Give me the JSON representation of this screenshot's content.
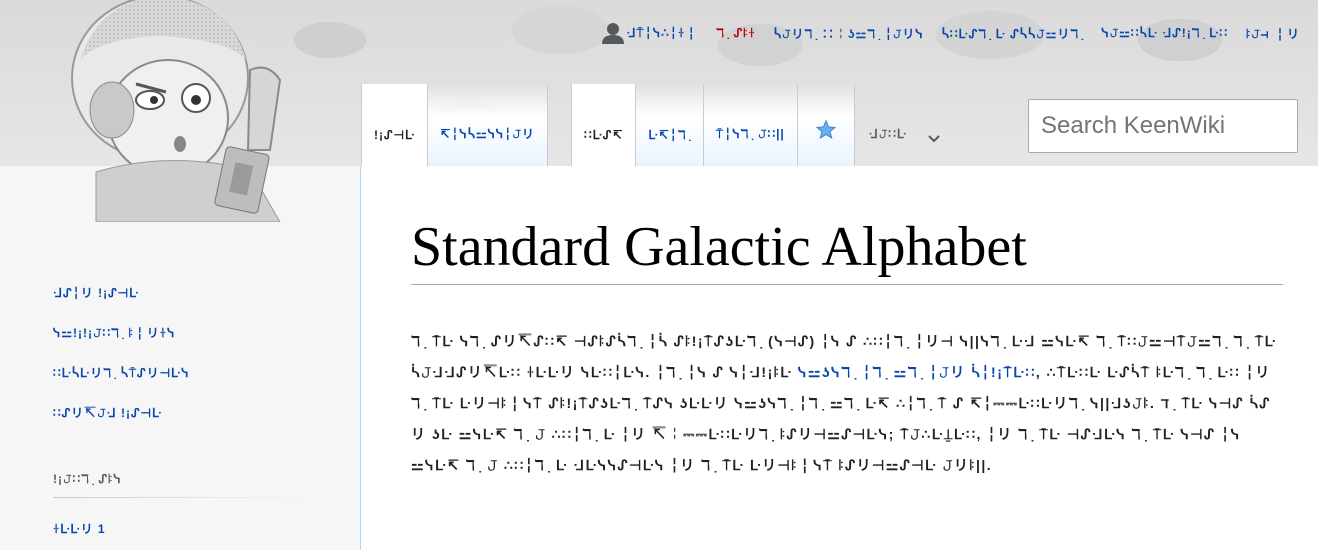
{
  "personal_tools": {
    "login": "ᒲ⍑╎ᓭ∴╎ꖌ╎",
    "talk": "ℸ ̣ ᔑꖎꖌ",
    "contributions": "ᓵ𝙹リℸ ̣ ∷╎ʖ⚍ℸ ̣ ╎𝙹リᓭ",
    "create_account": "ᓵ∷ᒷᔑℸ ̣ ᒷ ᔑᓵᓵ𝙹⚍リℸ ̣",
    "preferences": "ᓭ𝙹⚍∷ᓵᒷ ᒲᔑ!¡ℸ ̣ ᒷ∷",
    "log_in": "ꖎ𝙹⊣ ╎リ"
  },
  "tabs": {
    "page": "!¡ᔑ⊣ᒷ",
    "discussion": "↸╎ᓭᓵ⚍ᓭᓭ╎𝙹リ",
    "read": "∷ᒷᔑ↸",
    "edit": "ᒷ↸╎ℸ ̣",
    "history": "⍑╎ᓭℸ ̣ 𝙹∷||",
    "more": "ᒲ𝙹∷ᒷ"
  },
  "search": {
    "placeholder": "Search KeenWiki"
  },
  "sidebar": {
    "nav": [
      "ᒲᔑ╎リ !¡ᔑ⊣ᒷ",
      "ᓭ⚍!¡!¡𝙹∷ℸ ̣ ꖎ╎リꖌᓭ",
      "∷ᒷᓵᒷリℸ ̣ ᓵ⍑ᔑリ⊣ᒷᓭ",
      "∷ᔑリ↸𝙹ᒲ !¡ᔑ⊣ᒷ"
    ],
    "portal_heading": "!¡𝙹∷ℸ ̣ ᔑꖎᓭ",
    "portal_first": "ꖌᒷᒷリ 1"
  },
  "page_title": "Standard Galactic Alphabet",
  "article": {
    "p1": "ℸ ̣ ⍑ᒷ ",
    "bold": "ᓭℸ ̣ ᔑリ↸ᔑ∷↸ ⊣ᔑꖎᔑᓵℸ ̣ ╎ᓵ ᔑꖎ!¡⍑ᔑʖᒷℸ ̣",
    "p2": " (ᓭ⊣ᔑ) ╎ᓭ ᔑ ∴∷╎ℸ ̣ ╎リ⊣ ᓭ||ᓭℸ ̣ ᒷᒲ ⚍ᓭᒷ↸ ℸ ̣ ⍑∷𝙹⚍⊣⍑𝙹⚍ℸ ̣ ℸ ̣ ⍑ᒷ ᓵ𝙹ᒲᒲᔑリ↸ᒷ∷ ꖌᒷᒷリ ᓭᒷ∷╎ᒷᓭ. ╎ℸ ̣ ╎ᓭ ᔑ ᓭ╎ᒲ!¡ꖎᒷ ",
    "link": "ᓭ⚍ʖᓭℸ ̣ ╎ℸ ̣ ⚍ℸ ̣ ╎𝙹リ ᓵ╎!¡⍑ᒷ∷",
    "p3": ", ∴⍑ᒷ∷ᒷ ᒷᔑᓵ⍑ ꖎᒷℸ ̣ ℸ ̣ ᒷ∷ ╎リ ℸ ̣ ⍑ᒷ ᒷリ⊣ꖎ╎ᓭ⍑ ᔑꖎ!¡⍑ᔑʖᒷℸ ̣ ⍑ᔑᓭ ʖᒷᒷリ ᓭ⚍ʖᓭℸ ̣ ╎ℸ ̣ ⚍ℸ ̣ ᒷ↸ ∴╎ℸ ̣ ⍑ ᔑ ↸╎⎓⎓ᒷ∷ᒷリℸ ̣ ᓭ||ᒲʖ𝙹ꖎ. ℸ ̣ ⍑ᒷ ᓭ⊣ᔑ ᓵᔑリ ʖᒷ ⚍ᓭᒷ↸ ℸ ̣ 𝙹 ∴∷╎ℸ ̣ ᒷ ╎リ ↸╎⎓⎓ᒷ∷ᒷリℸ ̣ ꖎᔑリ⊣⚍ᔑ⊣ᒷᓭ; ⍑𝙹∴ᒷ⍊ᒷ∷, ╎リ ℸ ̣ ⍑ᒷ ⊣ᔑᒲᒷᓭ ℸ ̣ ⍑ᒷ ᓭ⊣ᔑ ╎ᓭ ⚍ᓭᒷ↸ ℸ ̣ 𝙹 ∴∷╎ℸ ̣ ᒷ ᒲᒷᓭᓭᔑ⊣ᒷᓭ ╎リ ℸ ̣ ⍑ᒷ ᒷリ⊣ꖎ╎ᓭ⍑ ꖎᔑリ⊣⚍ᔑ⊣ᒷ 𝙹リꖎ||."
  }
}
